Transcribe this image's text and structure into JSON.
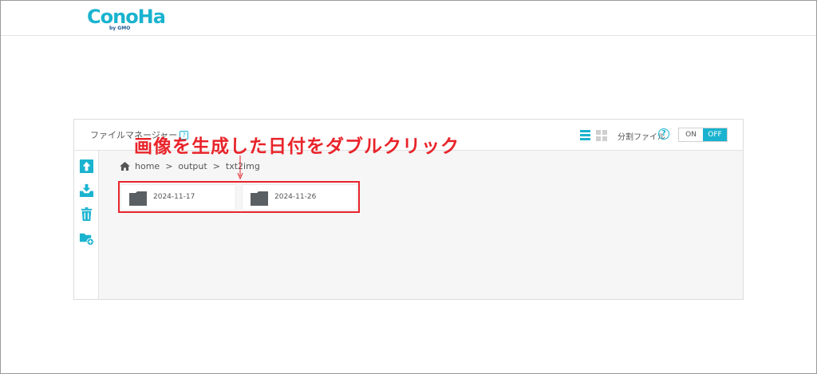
{
  "header": {
    "logo_text": "ConoHa",
    "logo_sub": "by GMO"
  },
  "panel": {
    "title": "ファイルマネージャー",
    "help_glyph": "?",
    "split_label": "分割ファイル",
    "split_help_glyph": "?",
    "toggle_on": "ON",
    "toggle_off": "OFF"
  },
  "breadcrumb": {
    "items": [
      "home",
      "output",
      "txt2img"
    ],
    "separator": ">"
  },
  "folders": [
    {
      "name": "2024-11-17"
    },
    {
      "name": "2024-11-26"
    }
  ],
  "annotation": {
    "text": "画像を生成した日付をダブルクリック",
    "color": "#e8242a"
  },
  "colors": {
    "accent": "#1ab3cf",
    "folder": "#5a5f63"
  },
  "icons": {
    "upload": "upload-icon",
    "download": "download-icon",
    "delete": "trash-icon",
    "new_folder": "folder-add-icon",
    "home": "home-icon",
    "list_view": "list-view-icon",
    "grid_view": "grid-view-icon",
    "folder": "folder-icon"
  }
}
